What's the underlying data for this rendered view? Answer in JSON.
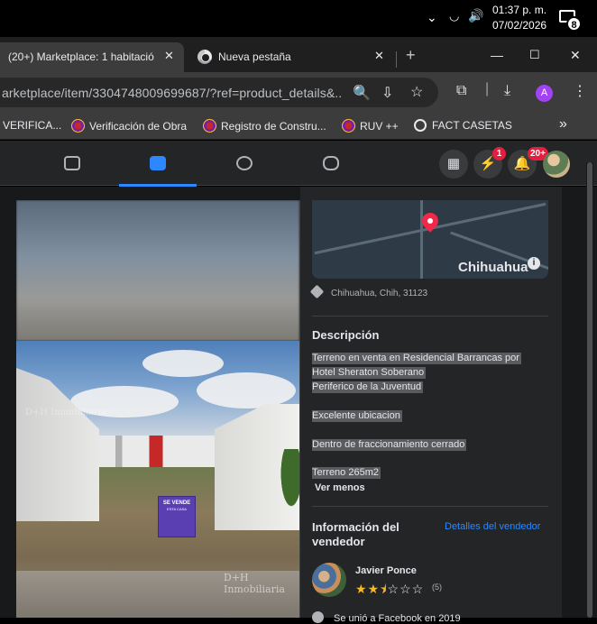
{
  "taskbar": {
    "time": "01:37 p. m.",
    "date": "07/02/2026",
    "notification_count": "8"
  },
  "tabs": [
    {
      "title": "(20+) Marketplace: 1 habitació",
      "active": true
    },
    {
      "title": "Nueva pestaña",
      "active": false
    }
  ],
  "address_bar": {
    "url": "arketplace/item/3304748009699687/?ref=product_details&..."
  },
  "profile_initial": "A",
  "bookmarks": [
    {
      "label": "VERIFICA..."
    },
    {
      "label": "Verificación de Obra"
    },
    {
      "label": "Registro de Constru..."
    },
    {
      "label": "RUV ++"
    },
    {
      "label": "FACT CASETAS"
    }
  ],
  "fb_nav": {
    "tabs": [
      "watch",
      "marketplace",
      "groups",
      "gaming"
    ],
    "active_tab": "marketplace",
    "messenger_badge": "1",
    "notifications_badge": "20+"
  },
  "photo": {
    "sign": {
      "line1": "SE VENDE",
      "line2": "ESTA CASA"
    },
    "watermark": "D+H Inmobiliaria"
  },
  "listing": {
    "map_city": "Chihuahua",
    "location": "Chihuahua, Chih, 31123",
    "description_title": "Descripción",
    "description_lines": [
      "Terreno en venta en Residencial Barrancas por",
      "Hotel Sheraton Soberano",
      "Periferico de la Juventud",
      "",
      "Excelente ubicacion",
      "",
      "Dentro de fraccionamiento cerrado",
      "",
      "Terreno 265m2"
    ],
    "see_less": "Ver menos",
    "seller_info_title": [
      "Información del",
      "vendedor"
    ],
    "seller_details_link": "Detalles del vendedor",
    "seller_name": "Javier Ponce",
    "seller_rating": 2.5,
    "seller_rating_count": "(5)",
    "joined": "Se unió a Facebook en 2019"
  },
  "colors": {
    "accent": "#2d88ff",
    "badge": "#e41e3f",
    "star": "#f7b928"
  }
}
